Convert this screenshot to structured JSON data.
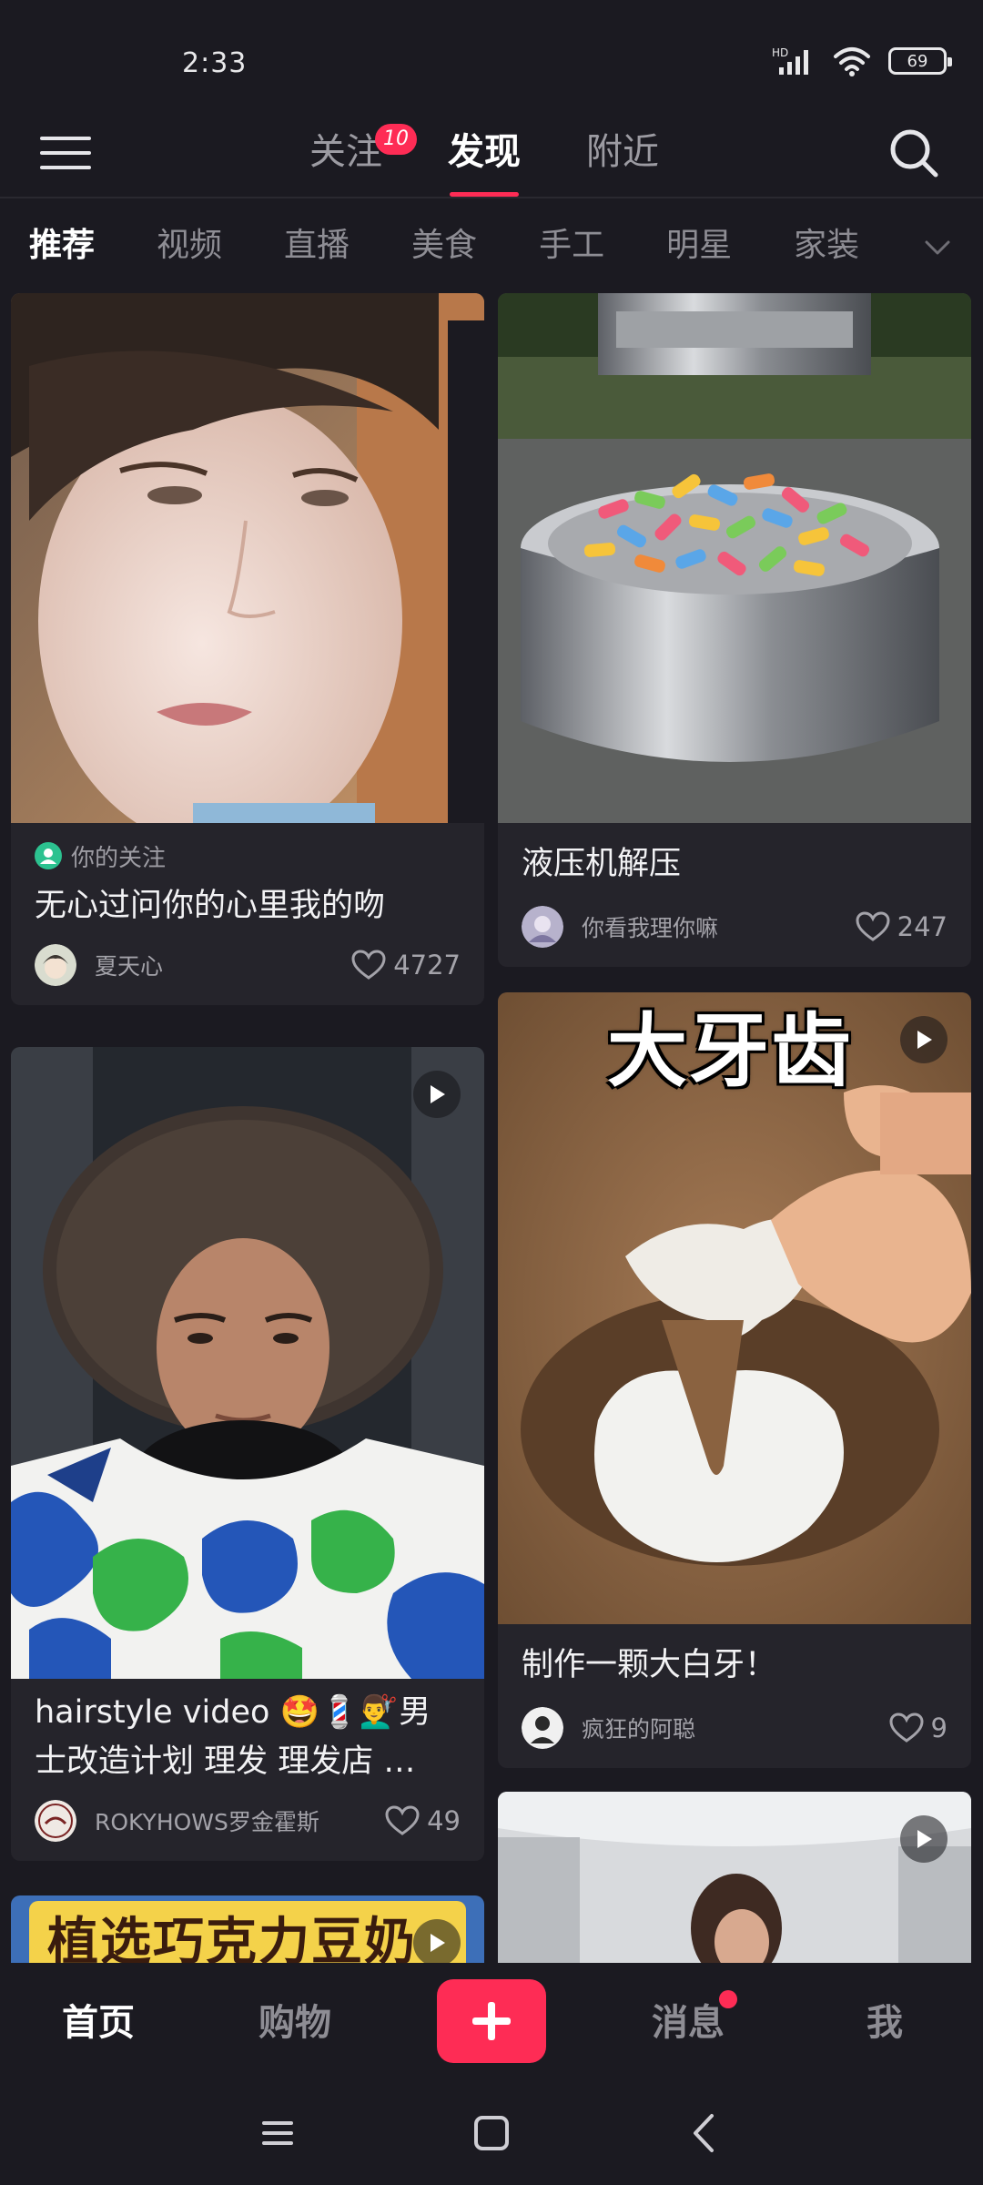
{
  "status": {
    "time": "2:33",
    "battery": "69",
    "network": "HD"
  },
  "top_nav": {
    "tabs": [
      {
        "label": "关注",
        "badge": "10"
      },
      {
        "label": "发现",
        "active": true
      },
      {
        "label": "附近"
      }
    ]
  },
  "categories": [
    "推荐",
    "视频",
    "直播",
    "美食",
    "手工",
    "明星",
    "家装"
  ],
  "feed": {
    "left": [
      {
        "tag": "你的关注",
        "title": "无心过问你的心里我的吻",
        "author": "夏天心",
        "likes": "4727",
        "is_video": false
      },
      {
        "title": "hairstyle video 🤩💈💇‍♂️男士改造计划 理发 理发店 …",
        "author": "ROKYHOWS罗金霍斯",
        "likes": "49",
        "is_video": true
      },
      {
        "overlay_text": "植选巧克力豆奶",
        "is_video": true
      }
    ],
    "right": [
      {
        "title": "液压机解压",
        "author": "你看我理你嘛",
        "likes": "247",
        "is_video": false
      },
      {
        "overlay_text": "大牙齿",
        "title": "制作一颗大白牙！",
        "author": "疯狂的阿聪",
        "likes": "9",
        "is_video": true
      },
      {
        "is_video": true
      }
    ]
  },
  "bottom_nav": {
    "home": "首页",
    "shop": "购物",
    "messages": "消息",
    "me": "我"
  },
  "colors": {
    "accent": "#fe2c55",
    "background": "#1b1a21",
    "card": "#25242b"
  },
  "icons": [
    "menu-icon",
    "search-icon",
    "chevron-down-icon",
    "heart-icon",
    "play-icon",
    "plus-icon",
    "user-icon",
    "wifi-icon",
    "signal-icon",
    "battery-icon"
  ]
}
